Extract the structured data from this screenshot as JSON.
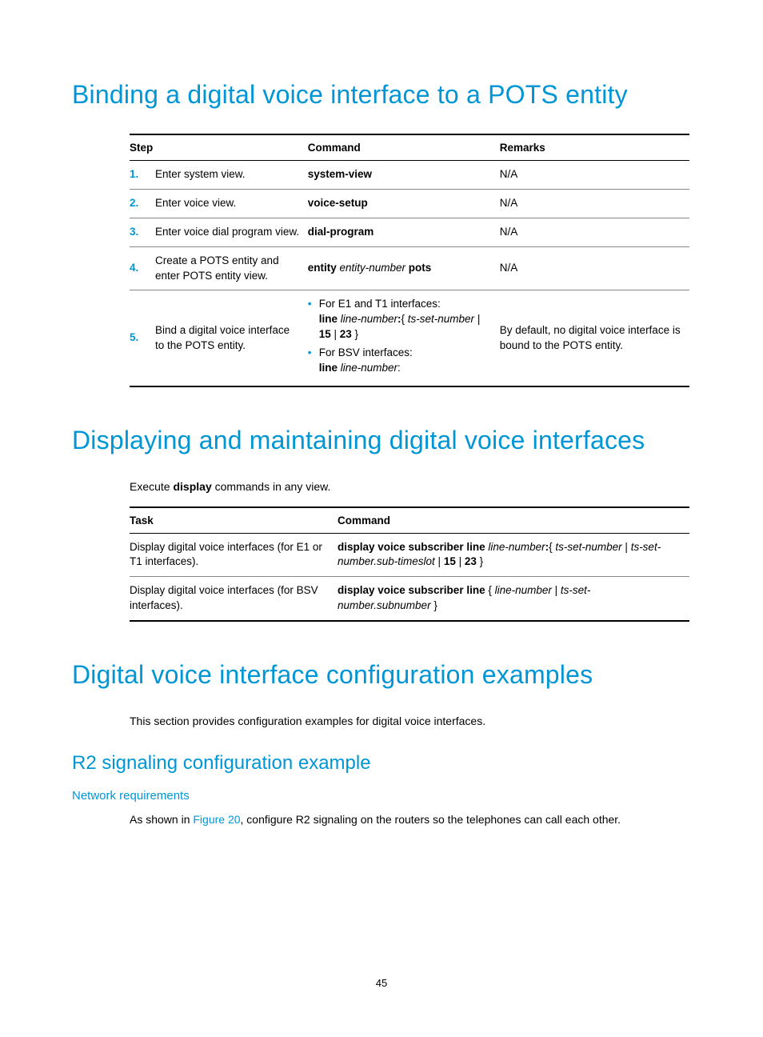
{
  "h1_1": "Binding a digital voice interface to a POTS entity",
  "table1": {
    "headers": {
      "step": "Step",
      "command": "Command",
      "remarks": "Remarks"
    },
    "rows": [
      {
        "num": "1.",
        "step": "Enter system view.",
        "cmd_bold": "system-view",
        "remarks": "N/A"
      },
      {
        "num": "2.",
        "step": "Enter voice view.",
        "cmd_bold": "voice-setup",
        "remarks": "N/A"
      },
      {
        "num": "3.",
        "step": "Enter voice dial program view.",
        "cmd_bold": "dial-program",
        "remarks": "N/A"
      },
      {
        "num": "4.",
        "step": "Create a POTS entity and enter POTS entity view.",
        "cmd_parts": [
          {
            "t": "entity ",
            "b": true
          },
          {
            "t": "entity-number",
            "i": true
          },
          {
            "t": " pots",
            "b": true
          }
        ],
        "remarks": "N/A"
      },
      {
        "num": "5.",
        "step": "Bind a digital voice interface to the POTS entity.",
        "bullets": [
          {
            "lead": "For E1 and T1 interfaces:",
            "parts": [
              {
                "t": "line ",
                "b": true
              },
              {
                "t": "line-number",
                "i": true
              },
              {
                "t": ":",
                "b": true
              },
              {
                "t": "{ ",
                "i": false
              },
              {
                "t": "ts-set-number",
                "i": true
              },
              {
                "t": " | ",
                "i": false
              },
              {
                "t": "15",
                "b": true
              },
              {
                "t": " | ",
                "i": false
              },
              {
                "t": "23",
                "b": true
              },
              {
                "t": " }",
                "i": false
              }
            ]
          },
          {
            "lead": "For BSV interfaces:",
            "parts": [
              {
                "t": "line ",
                "b": true
              },
              {
                "t": "line-number",
                "i": true
              },
              {
                "t": ":",
                "i": false
              }
            ]
          }
        ],
        "remarks": "By default, no digital voice interface is bound to the POTS entity."
      }
    ]
  },
  "h1_2": "Displaying and maintaining digital voice interfaces",
  "p2_pre": "Execute ",
  "p2_bold": "display",
  "p2_post": " commands in any view.",
  "table2": {
    "headers": {
      "task": "Task",
      "command": "Command"
    },
    "rows": [
      {
        "task": "Display digital voice interfaces (for E1 or T1 interfaces).",
        "parts": [
          {
            "t": "display voice subscriber line ",
            "b": true
          },
          {
            "t": "line-number",
            "i": true
          },
          {
            "t": ":",
            "b": true
          },
          {
            "t": "{ ",
            "i": false
          },
          {
            "t": "ts-set-number",
            "i": true
          },
          {
            "t": " | ",
            "i": false
          },
          {
            "t": "ts-set-number.sub-timeslot",
            "i": true
          },
          {
            "t": " | ",
            "i": false
          },
          {
            "t": "15",
            "b": true
          },
          {
            "t": " | ",
            "i": false
          },
          {
            "t": "23",
            "b": true
          },
          {
            "t": " }",
            "i": false
          }
        ]
      },
      {
        "task": "Display digital voice interfaces (for BSV interfaces).",
        "parts": [
          {
            "t": "display voice subscriber line ",
            "b": true
          },
          {
            "t": "{ ",
            "i": false
          },
          {
            "t": "line-number",
            "i": true
          },
          {
            "t": " | ",
            "i": false
          },
          {
            "t": "ts-set-number.subnumber",
            "i": true
          },
          {
            "t": " }",
            "i": false
          }
        ]
      }
    ]
  },
  "h1_3": "Digital voice interface configuration examples",
  "p3": "This section provides configuration examples for digital voice interfaces.",
  "h2_1": "R2 signaling configuration example",
  "h3_1": "Network requirements",
  "p4_pre": "As shown in ",
  "p4_link": "Figure 20",
  "p4_post": ", configure R2 signaling on the routers so the telephones can call each other.",
  "page_number": "45"
}
